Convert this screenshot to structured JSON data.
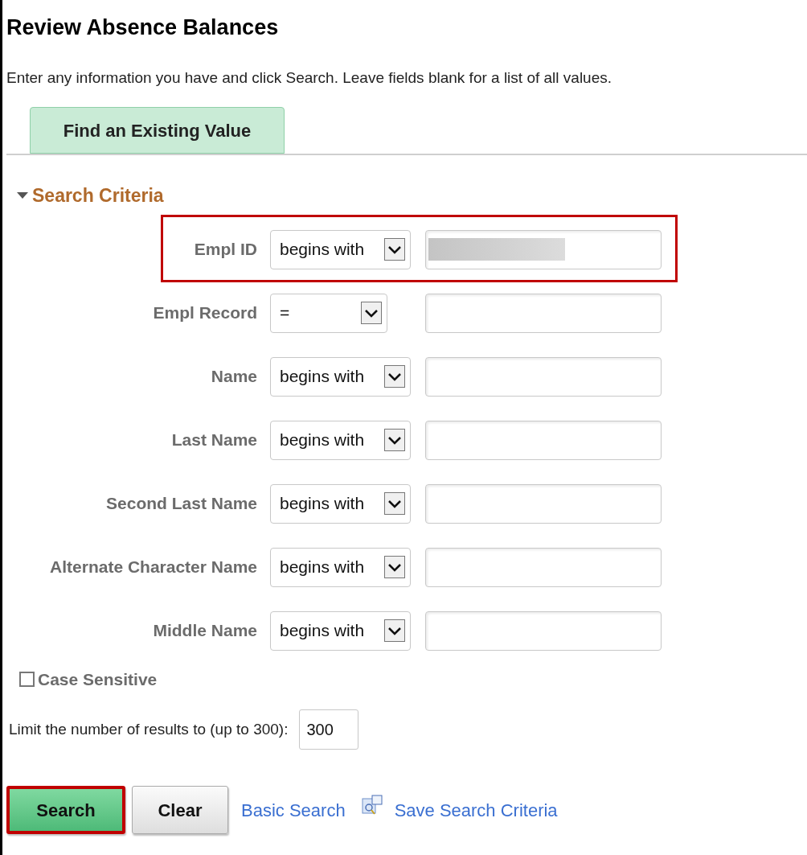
{
  "page": {
    "title": "Review Absence Balances",
    "instructions": "Enter any information you have and click Search. Leave fields blank for a list of all values."
  },
  "tabs": [
    {
      "label": "Find an Existing Value",
      "selected": true
    }
  ],
  "section": {
    "title": "Search Criteria",
    "expanded": true
  },
  "fields": [
    {
      "label": "Empl ID",
      "operator": "begins with",
      "redacted": true,
      "highlighted": true
    },
    {
      "label": "Empl Record",
      "operator": "=",
      "redacted": false,
      "highlighted": false
    },
    {
      "label": "Name",
      "operator": "begins with",
      "redacted": false,
      "highlighted": false
    },
    {
      "label": "Last Name",
      "operator": "begins with",
      "redacted": false,
      "highlighted": false
    },
    {
      "label": "Second Last Name",
      "operator": "begins with",
      "redacted": false,
      "highlighted": false
    },
    {
      "label": "Alternate Character Name",
      "operator": "begins with",
      "redacted": false,
      "highlighted": false
    },
    {
      "label": "Middle Name",
      "operator": "begins with",
      "redacted": false,
      "highlighted": false
    }
  ],
  "case_sensitive": {
    "label": "Case Sensitive",
    "checked": false
  },
  "limit": {
    "label": "Limit the number of results to (up to 300):",
    "value": "300"
  },
  "actions": [
    {
      "kind": "primary",
      "label": "Search",
      "highlighted": true
    },
    {
      "kind": "secondary",
      "label": "Clear",
      "highlighted": false
    },
    {
      "kind": "link",
      "label": "Basic Search"
    },
    {
      "kind": "icon-link",
      "label": "Save Search Criteria"
    }
  ]
}
